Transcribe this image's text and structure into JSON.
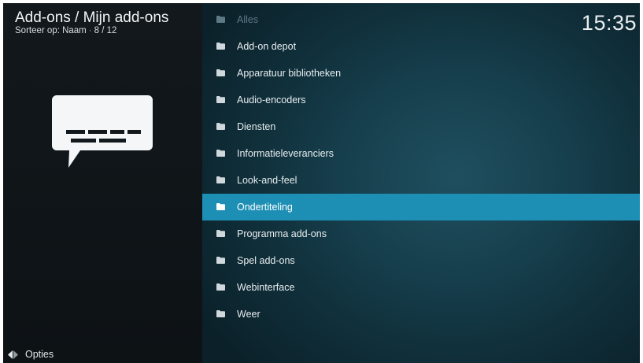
{
  "header": {
    "title": "Add-ons / Mijn add-ons",
    "sort_label": "Sorteer op: Naam",
    "separator": "·",
    "position": "8 / 12"
  },
  "clock": "15:35",
  "footer": {
    "options_label": "Opties",
    "options_icon": "options-arrows-icon"
  },
  "preview": {
    "icon": "subtitle-speech-bubble-icon"
  },
  "list": {
    "items": [
      {
        "label": "Alles",
        "icon": "folder-icon",
        "state": "dim"
      },
      {
        "label": "Add-on depot",
        "icon": "folder-icon",
        "state": "normal"
      },
      {
        "label": "Apparatuur bibliotheken",
        "icon": "folder-icon",
        "state": "normal"
      },
      {
        "label": "Audio-encoders",
        "icon": "folder-icon",
        "state": "normal"
      },
      {
        "label": "Diensten",
        "icon": "folder-icon",
        "state": "normal"
      },
      {
        "label": "Informatieleveranciers",
        "icon": "folder-icon",
        "state": "normal"
      },
      {
        "label": "Look-and-feel",
        "icon": "folder-icon",
        "state": "normal"
      },
      {
        "label": "Ondertiteling",
        "icon": "folder-icon",
        "state": "selected"
      },
      {
        "label": "Programma add-ons",
        "icon": "folder-icon",
        "state": "normal"
      },
      {
        "label": "Spel add-ons",
        "icon": "folder-icon",
        "state": "normal"
      },
      {
        "label": "Webinterface",
        "icon": "folder-icon",
        "state": "normal"
      },
      {
        "label": "Weer",
        "icon": "folder-icon",
        "state": "normal"
      }
    ]
  },
  "colors": {
    "selection": "#1e8fb4",
    "panel_bg": "#12181c",
    "list_bg": "#17404e"
  }
}
